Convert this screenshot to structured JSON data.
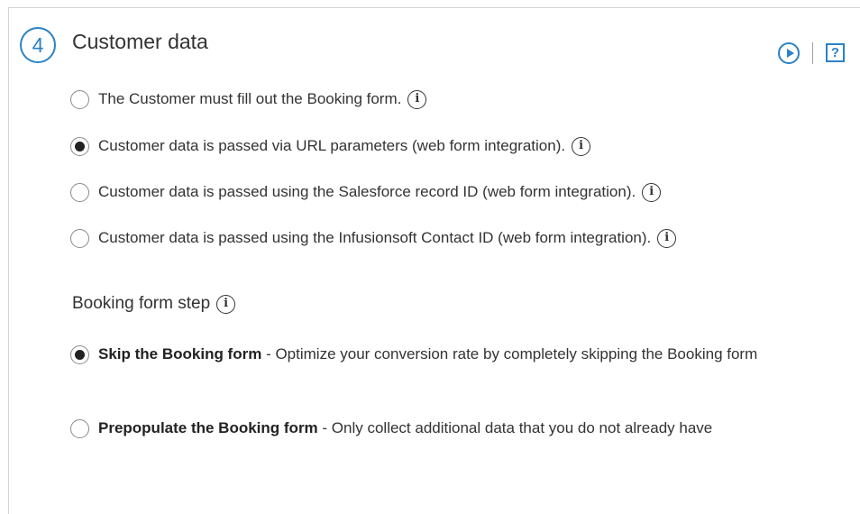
{
  "section": {
    "number": "4",
    "title": "Customer data",
    "help_label": "?"
  },
  "customer_options": [
    {
      "label": "The Customer must fill out the Booking form.",
      "checked": false
    },
    {
      "label": "Customer data is passed via URL parameters (web form integration).",
      "checked": true
    },
    {
      "label": "Customer data is passed using the Salesforce record ID (web form integration).",
      "checked": false
    },
    {
      "label": "Customer data is passed using the Infusionsoft Contact ID (web form integration).",
      "checked": false
    }
  ],
  "info_glyph": "i",
  "booking_step": {
    "label": "Booking form step",
    "options": [
      {
        "title": "Skip the Booking form",
        "description": " - Optimize your conversion rate by completely skipping the Booking form",
        "checked": true
      },
      {
        "title": "Prepopulate the Booking form",
        "description": " - Only collect additional data that you do not already have",
        "checked": false
      }
    ]
  },
  "colors": {
    "accent": "#2a82c6",
    "text": "#333333",
    "border": "#d3d3d3"
  },
  "icons": [
    "play-icon",
    "help-icon",
    "info-icon",
    "radio-icon"
  ]
}
